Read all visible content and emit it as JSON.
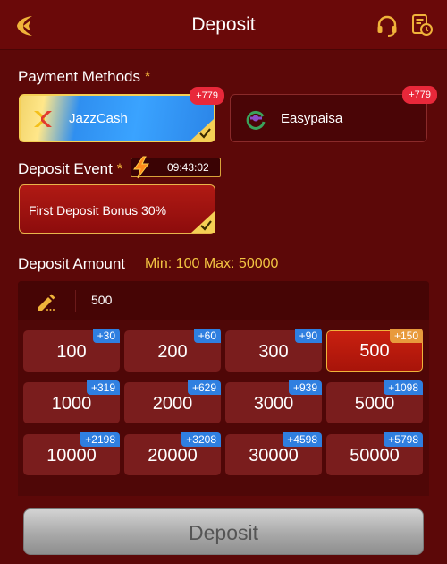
{
  "header": {
    "title": "Deposit"
  },
  "payment": {
    "label": "Payment Methods",
    "required_mark": "*",
    "methods": [
      {
        "name": "JazzCash",
        "bonus": "+779",
        "selected": true
      },
      {
        "name": "Easypaisa",
        "bonus": "+779",
        "selected": false
      }
    ]
  },
  "event": {
    "label": "Deposit Event",
    "required_mark": "*",
    "timer": "09:43:02",
    "selected_event": "First Deposit Bonus 30%"
  },
  "amount": {
    "label": "Deposit Amount",
    "min_max": "Min: 100  Max: 50000",
    "input_value": "500",
    "options": [
      {
        "value": "100",
        "bonus": "+30"
      },
      {
        "value": "200",
        "bonus": "+60"
      },
      {
        "value": "300",
        "bonus": "+90"
      },
      {
        "value": "500",
        "bonus": "+150",
        "selected": true
      },
      {
        "value": "1000",
        "bonus": "+319"
      },
      {
        "value": "2000",
        "bonus": "+629"
      },
      {
        "value": "3000",
        "bonus": "+939"
      },
      {
        "value": "5000",
        "bonus": "+1098"
      },
      {
        "value": "10000",
        "bonus": "+2198"
      },
      {
        "value": "20000",
        "bonus": "+3208"
      },
      {
        "value": "30000",
        "bonus": "+4598"
      },
      {
        "value": "50000",
        "bonus": "+5798"
      }
    ]
  },
  "footer": {
    "deposit_label": "Deposit"
  },
  "colors": {
    "background": "#5c0808",
    "accent_gold": "#f2c442",
    "bonus_red": "#e8283a",
    "bonus_blue": "#2f7fe0",
    "selected_bonus": "#e89a3c"
  },
  "icons": {
    "back": "back-arrow-icon",
    "support": "headset-icon",
    "history": "history-icon",
    "jazzcash": "jazzcash-logo",
    "easypaisa": "easypaisa-logo",
    "timer": "lightning-icon",
    "edit": "pencil-icon",
    "check": "check-icon"
  }
}
